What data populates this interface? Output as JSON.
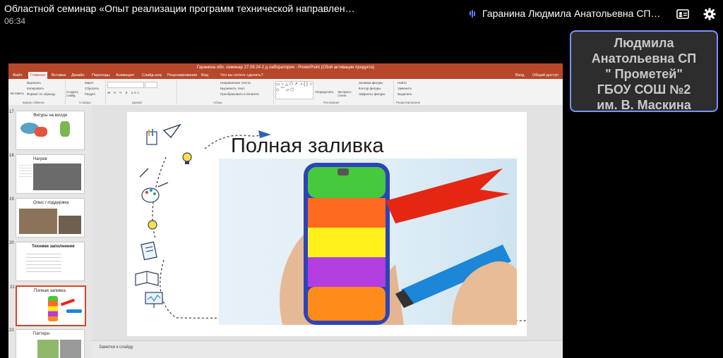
{
  "meeting": {
    "title": "Областной семинар «Опыт реализации программ технической направлен…",
    "elapsed": "06:34"
  },
  "speaker": {
    "name": "Гаранина Людмила Анатольевна СП…",
    "icons": [
      "speaking-indicator-icon",
      "participant-card-icon",
      "settings-gear-icon"
    ]
  },
  "participant_tile": {
    "name_lines": [
      "Людмила",
      "Анатольевна СП",
      "\" Прометей\"",
      "ГБОУ СОШ №2",
      "им. В. Маскина"
    ],
    "border_color": "#7a93ff"
  },
  "powerpoint": {
    "title_bar": "Гаранина обл. семинар 27.09.24 2 д лаборатория - PowerPoint (Сбой активации продукта)",
    "brand_color": "#b7472a",
    "tabs": [
      "Файл",
      "Главная",
      "Вставка",
      "Дизайн",
      "Переходы",
      "Анимация",
      "Слайд-шоу",
      "Рецензирование",
      "Вид"
    ],
    "tell_me": "Что вы хотите сделать?",
    "sign_in": "Вход",
    "share": "Общий доступ",
    "ribbon_groups": [
      "Буфер обмена",
      "Слайды",
      "Шрифт",
      "Абзац",
      "Рисование",
      "Редактирование"
    ],
    "ribbon_items": {
      "paste": "Вставить",
      "cut": "Вырезать",
      "copy": "Копировать",
      "format_painter": "Формат по образцу",
      "new_slide": "Создать слайд",
      "layout": "Макет",
      "reset": "Сбросить",
      "section": "Раздел",
      "text_direction": "Направление текста",
      "align_text": "Выровнять текст",
      "smartart": "Преобразовать в SmartArt",
      "arrange": "Упорядочить",
      "quick_styles": "Экспресс-стили",
      "shape_fill": "Заливка фигуры",
      "shape_outline": "Контур фигуры",
      "shape_effects": "Эффекты фигуры",
      "find": "Найти",
      "replace": "Заменить",
      "select": "Выделить"
    },
    "thumbnails": [
      {
        "num": "17",
        "caption": "Фигуры на молде"
      },
      {
        "num": "18",
        "caption": "Нагрев"
      },
      {
        "num": "19",
        "caption": "Опыс / поддержка"
      },
      {
        "num": "20",
        "caption": "Техники заполнения"
      },
      {
        "num": "21",
        "caption": "Полная заливка"
      },
      {
        "num": "22",
        "caption": "Паттерн"
      }
    ],
    "slide_title": "Полная заливка",
    "notes_placeholder": "Заметки к слайду"
  }
}
